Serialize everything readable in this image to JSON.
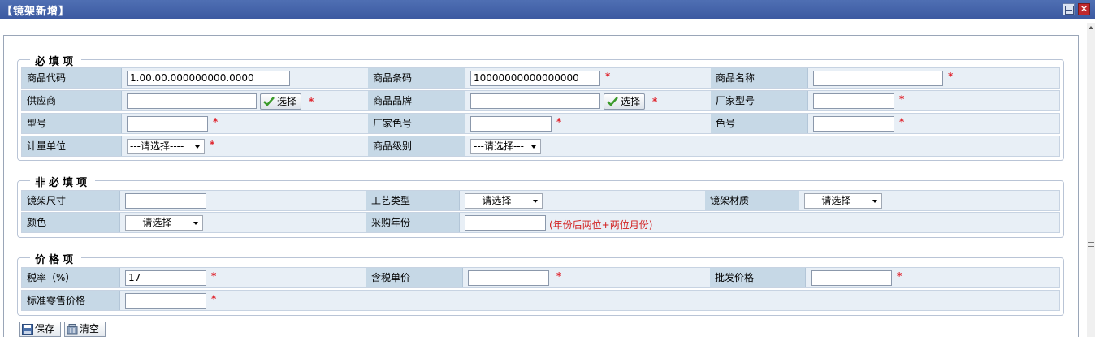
{
  "window": {
    "title": "【镜架新增】",
    "close_glyph": "✕"
  },
  "sections": {
    "required": "必填项",
    "optional": "非必填项",
    "price": "价格项"
  },
  "required": {
    "code_label": "商品代码",
    "code_value": "1.00.00.000000000.0000",
    "barcode_label": "商品条码",
    "barcode_value": "10000000000000000",
    "name_label": "商品名称",
    "name_value": "",
    "supplier_label": "供应商",
    "supplier_value": "",
    "brand_label": "商品品牌",
    "brand_value": "",
    "maker_model_label": "厂家型号",
    "maker_model_value": "",
    "model_label": "型号",
    "model_value": "",
    "maker_color_label": "厂家色号",
    "maker_color_value": "",
    "color_no_label": "色号",
    "color_no_value": "",
    "unit_label": "计量单位",
    "unit_value": "---请选择----",
    "grade_label": "商品级别",
    "grade_value": "---请选择---",
    "choose_label": "选择"
  },
  "optional": {
    "size_label": "镜架尺寸",
    "size_value": "",
    "craft_label": "工艺类型",
    "craft_value": "----请选择----",
    "material_label": "镜架材质",
    "material_value": "----请选择----",
    "color_label": "颜色",
    "color_value": "----请选择----",
    "year_label": "采购年份",
    "year_value": "",
    "year_hint": "(年份后两位+两位月份)"
  },
  "price": {
    "tax_label": "税率（%）",
    "tax_value": "17",
    "unit_price_label": "含税单价",
    "unit_price_value": "",
    "wholesale_label": "批发价格",
    "wholesale_value": "",
    "retail_label": "标准零售价格",
    "retail_value": ""
  },
  "actions": {
    "save": "保存",
    "clear": "清空"
  },
  "required_mark": "*",
  "colors": {
    "title_bar": "#4f6fb3",
    "label_bg": "#c6d8e6",
    "row_bg": "#e8eff6",
    "required_mark": "#e0262f",
    "hint": "#d22020"
  }
}
